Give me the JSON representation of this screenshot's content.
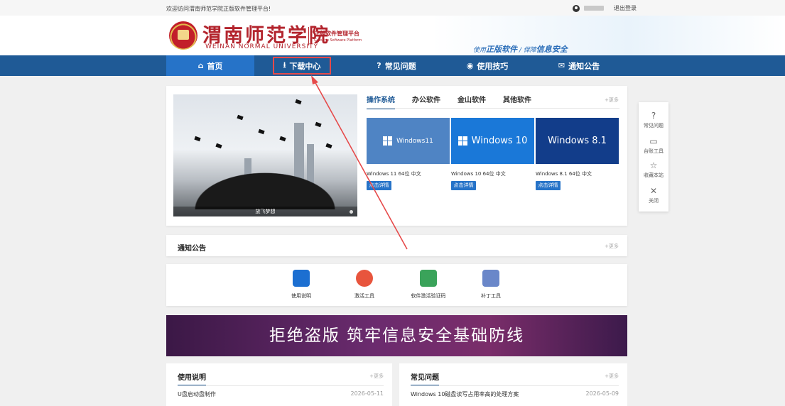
{
  "topbar": {
    "welcome": "欢迎访问渭南师范学院正版软件管理平台!",
    "logout": "退出登录"
  },
  "header": {
    "logo_cn": "渭南师范学院",
    "logo_en": "WEINAN NORMAL UNIVERSITY",
    "platform_cn": "正版软件管理平台",
    "platform_en": "Genuine Software Platform",
    "slogan_a": "使用",
    "slogan_b": "正版软件",
    "slogan_sep": " / ",
    "slogan_c": "保障",
    "slogan_d": "信息安全"
  },
  "nav": [
    {
      "label": "首页",
      "icon": "⌂"
    },
    {
      "label": "下载中心",
      "icon": "⭳"
    },
    {
      "label": "常见问题",
      "icon": "?"
    },
    {
      "label": "使用技巧",
      "icon": "◉"
    },
    {
      "label": "通知公告",
      "icon": "✉"
    }
  ],
  "featured": {
    "caption": "放飞梦想",
    "tabs": [
      "操作系统",
      "办公软件",
      "金山软件",
      "其他软件"
    ],
    "more": "+更多",
    "os": [
      {
        "tile": "Windows11",
        "name": "Windows 11 64位 中文",
        "button": "点击详情",
        "color": "#4f84c4"
      },
      {
        "tile": "Windows 10",
        "name": "Windows 10 64位 中文",
        "button": "点击详情",
        "color": "#1a78d8"
      },
      {
        "tile": "Windows 8.1",
        "name": "Windows 8.1 64位 中文",
        "button": "点击详情",
        "color": "#123d8a"
      }
    ]
  },
  "side_float": [
    {
      "label": "常见问题",
      "icon": "?"
    },
    {
      "label": "台账工具",
      "icon": "▭"
    },
    {
      "label": "收藏本站",
      "icon": "☆"
    },
    {
      "label": "关闭",
      "icon": "✕"
    }
  ],
  "notice": {
    "title": "通知公告",
    "more": "+更多"
  },
  "tools": [
    {
      "label": "使用说明",
      "color": "#1c6fd1"
    },
    {
      "label": "激活工具",
      "color": "#e8553d"
    },
    {
      "label": "软件激活验证码",
      "color": "#3aa35a"
    },
    {
      "label": "补丁工具",
      "color": "#6a87c9"
    }
  ],
  "banner": {
    "text": "拒绝盗版 筑牢信息安全基础防线"
  },
  "lists": [
    {
      "title": "使用说明",
      "more": "+更多",
      "item": "U盘启动盘制作",
      "date": "2026-05-11"
    },
    {
      "title": "常见问题",
      "more": "+更多",
      "item": "Windows 10磁盘读写占用率高的处理方案",
      "date": "2026-05-09"
    }
  ]
}
